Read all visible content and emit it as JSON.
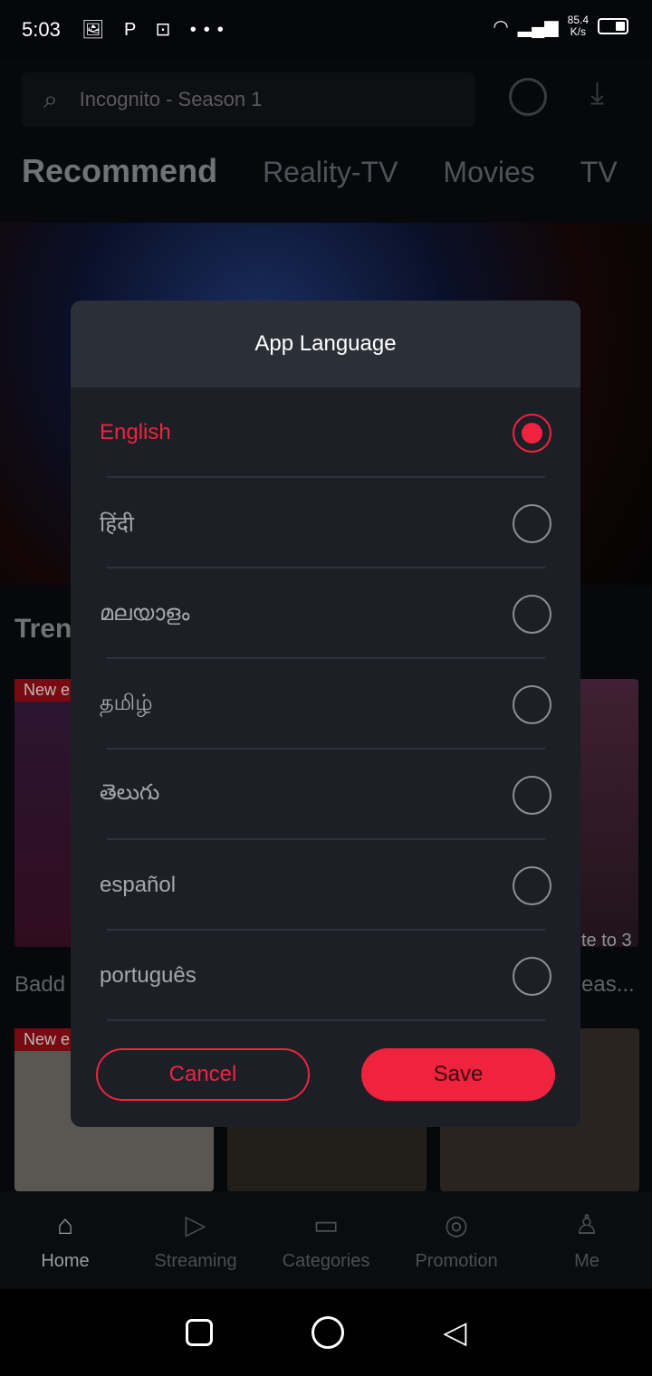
{
  "status_bar": {
    "time": "5:03",
    "speed_value": "85.4",
    "speed_unit": "K/s"
  },
  "search": {
    "placeholder": "Incognito - Season 1"
  },
  "tabs": [
    {
      "label": "Recommend"
    },
    {
      "label": "Reality-TV"
    },
    {
      "label": "Movies"
    },
    {
      "label": "TV"
    }
  ],
  "section": {
    "title": "Tren"
  },
  "cards": [
    {
      "badge": "New e",
      "title": "Badd",
      "overlay": ""
    },
    {
      "badge": "New e",
      "title": "eas...",
      "overlay": "te to 3"
    }
  ],
  "bottom_nav": [
    {
      "label": "Home",
      "icon": "home-icon"
    },
    {
      "label": "Streaming",
      "icon": "play-screen-icon"
    },
    {
      "label": "Categories",
      "icon": "folder-icon"
    },
    {
      "label": "Promotion",
      "icon": "gamepad-icon"
    },
    {
      "label": "Me",
      "icon": "person-icon"
    }
  ],
  "dialog": {
    "title": "App Language",
    "options": [
      {
        "label": "English",
        "selected": true
      },
      {
        "label": "हिंदी",
        "selected": false
      },
      {
        "label": "മലയാളം",
        "selected": false
      },
      {
        "label": "தமிழ்",
        "selected": false
      },
      {
        "label": "తెలుగు",
        "selected": false
      },
      {
        "label": "español",
        "selected": false
      },
      {
        "label": "português",
        "selected": false
      }
    ],
    "cancel_label": "Cancel",
    "save_label": "Save"
  },
  "colors": {
    "accent": "#f0233f",
    "dialog_bg": "#1c1f26",
    "header_bg": "#2b3038"
  }
}
